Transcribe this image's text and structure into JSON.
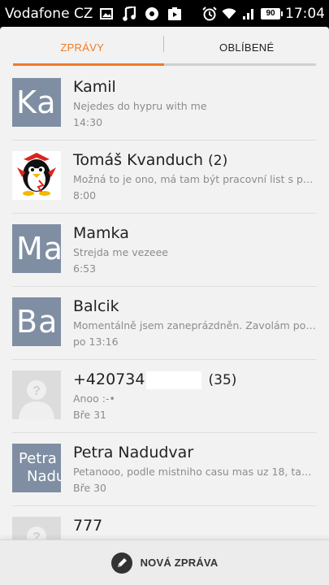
{
  "statusbar": {
    "carrier": "Vodafone CZ",
    "battery": "90",
    "time": "17:04",
    "icons": [
      "image-icon",
      "music-icon",
      "chat-icon",
      "play-icon",
      "alarm-icon",
      "wifi-icon",
      "signal-icon",
      "battery-icon"
    ]
  },
  "tabs": {
    "messages": "ZPRÁVY",
    "favorites": "OBLÍBENÉ",
    "active": "messages",
    "accent_color": "#f07a26"
  },
  "conversations": [
    {
      "name": "Kamil",
      "count": "",
      "preview": "Nejedes do hypru with me",
      "time": "14:30",
      "avatar_letters": "Ka",
      "avatar_type": "letters"
    },
    {
      "name": "Tomáš Kvanduch",
      "count": "(2)",
      "preview": "Možná to je ono, má tam být pracovní list s pos…",
      "time": "8:00",
      "avatar_letters": "",
      "avatar_type": "photo"
    },
    {
      "name": "Mamka",
      "count": "",
      "preview": "Strejda me  vezeee",
      "time": "6:53",
      "avatar_letters": "Ma",
      "avatar_type": "letters"
    },
    {
      "name": "Balcik",
      "count": "",
      "preview": "Momentálně jsem zaneprázdněn. Zavolám poz…",
      "time": "po 13:16",
      "avatar_letters": "Ba",
      "avatar_type": "letters"
    },
    {
      "name": "+420734",
      "count": "(35)",
      "preview": "Anoo :-•",
      "time": "Bře 31",
      "avatar_letters": "",
      "avatar_type": "generic"
    },
    {
      "name": "Petra Nadudvar",
      "count": "",
      "preview": "Petanooo, podle mistniho casu mas uz 18, tak…",
      "time": "Bře 30",
      "avatar_line1": "Petra",
      "avatar_line2": "Nadu",
      "avatar_type": "letters-small"
    },
    {
      "name": "777",
      "count": "",
      "preview": "",
      "time": "",
      "avatar_letters": "",
      "avatar_type": "generic"
    }
  ],
  "bottom": {
    "compose_label": "NOVÁ ZPRÁVA"
  }
}
